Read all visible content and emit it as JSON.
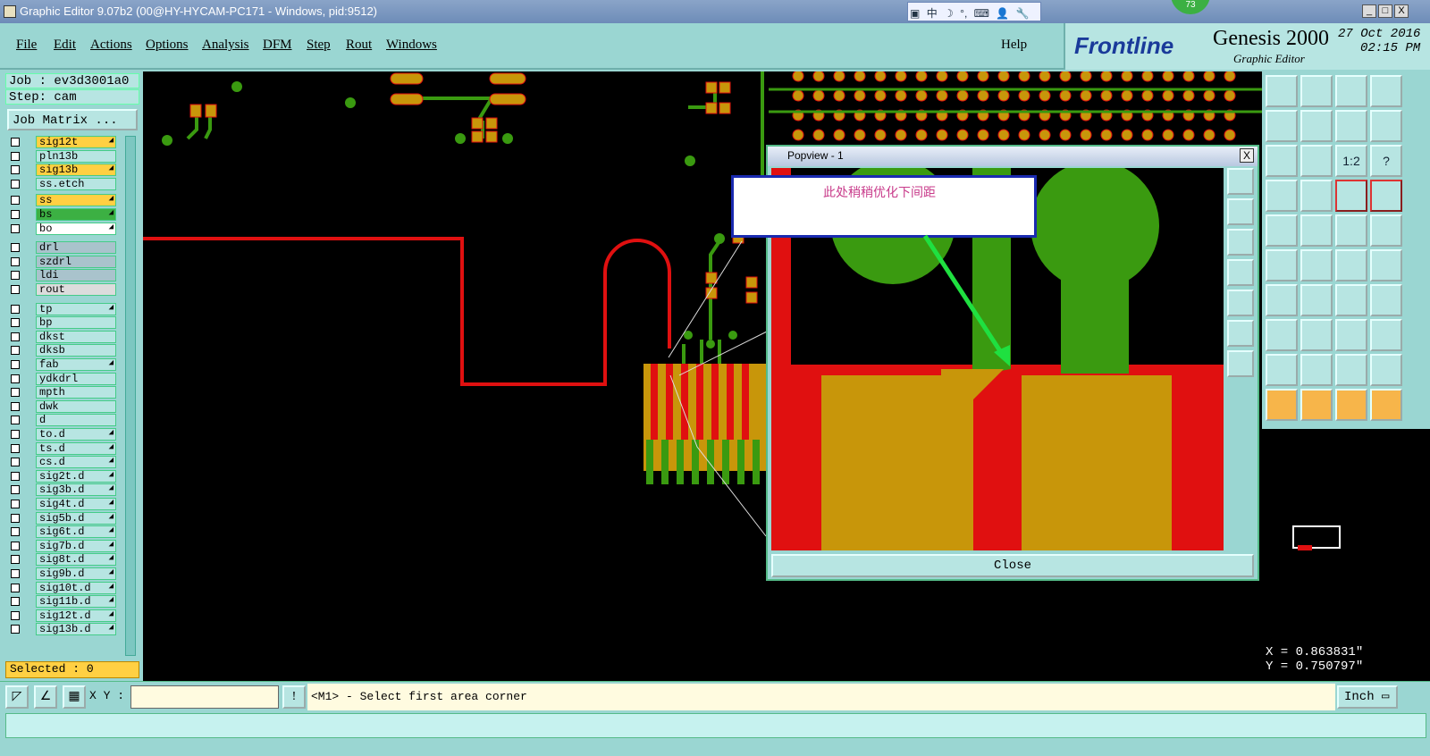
{
  "window": {
    "title": "Graphic Editor 9.07b2 (00@HY-HYCAM-PC171 - Windows, pid:9512)",
    "badge": "73",
    "min": "_",
    "max": "□",
    "close": "X"
  },
  "ime": {
    "items": [
      "中",
      "☽",
      "°,",
      "⌨",
      "👤",
      "🔧"
    ]
  },
  "menu": {
    "items": [
      "File",
      "Edit",
      "Actions",
      "Options",
      "Analysis",
      "DFM",
      "Step",
      "Rout",
      "Windows"
    ],
    "help": "Help"
  },
  "brand": {
    "logo": "Frontline",
    "product": "Genesis 2000",
    "subtitle": "Graphic Editor",
    "date": "27 Oct 2016",
    "time": "02:15 PM"
  },
  "left": {
    "job": "Job : ev3d3001a0",
    "step": "Step: cam",
    "job_matrix": "Job Matrix ...",
    "selected": "Selected : 0",
    "layers": [
      {
        "name": "sig12t",
        "color": "#ffd043",
        "arrow": true
      },
      {
        "name": "pln13b",
        "color": "#b7e5e2",
        "arrow": false
      },
      {
        "name": "sig13b",
        "color": "#ffd043",
        "arrow": true
      },
      {
        "name": "ss.etch",
        "color": "#b7e5e2",
        "arrow": false
      },
      {
        "name": "ss",
        "color": "#ffd043",
        "arrow": true
      },
      {
        "name": "bs",
        "color": "#3cb043",
        "arrow": true
      },
      {
        "name": "bo",
        "color": "#ffffff",
        "arrow": true
      },
      {
        "name": "drl",
        "color": "#a9c3cc",
        "arrow": false
      },
      {
        "name": "szdrl",
        "color": "#a9c3cc",
        "arrow": false
      },
      {
        "name": "ldi",
        "color": "#a9c3cc",
        "arrow": false
      },
      {
        "name": "rout",
        "color": "#dcdcdc",
        "arrow": false
      },
      {
        "name": "tp",
        "color": "#b7e5e2",
        "arrow": true
      },
      {
        "name": "bp",
        "color": "#b7e5e2",
        "arrow": false
      },
      {
        "name": "dkst",
        "color": "#b7e5e2",
        "arrow": false
      },
      {
        "name": "dksb",
        "color": "#b7e5e2",
        "arrow": false
      },
      {
        "name": "fab",
        "color": "#b7e5e2",
        "arrow": true
      },
      {
        "name": "ydkdrl",
        "color": "#b7e5e2",
        "arrow": false
      },
      {
        "name": "mpth",
        "color": "#b7e5e2",
        "arrow": false
      },
      {
        "name": "dwk",
        "color": "#b7e5e2",
        "arrow": false
      },
      {
        "name": "d",
        "color": "#b7e5e2",
        "arrow": false
      },
      {
        "name": "to.d",
        "color": "#b7e5e2",
        "arrow": true
      },
      {
        "name": "ts.d",
        "color": "#b7e5e2",
        "arrow": true
      },
      {
        "name": "cs.d",
        "color": "#b7e5e2",
        "arrow": true
      },
      {
        "name": "sig2t.d",
        "color": "#b7e5e2",
        "arrow": true
      },
      {
        "name": "sig3b.d",
        "color": "#b7e5e2",
        "arrow": true
      },
      {
        "name": "sig4t.d",
        "color": "#b7e5e2",
        "arrow": true
      },
      {
        "name": "sig5b.d",
        "color": "#b7e5e2",
        "arrow": true
      },
      {
        "name": "sig6t.d",
        "color": "#b7e5e2",
        "arrow": true
      },
      {
        "name": "sig7b.d",
        "color": "#b7e5e2",
        "arrow": true
      },
      {
        "name": "sig8t.d",
        "color": "#b7e5e2",
        "arrow": true
      },
      {
        "name": "sig9b.d",
        "color": "#b7e5e2",
        "arrow": true
      },
      {
        "name": "sig10t.d",
        "color": "#b7e5e2",
        "arrow": true
      },
      {
        "name": "sig11b.d",
        "color": "#b7e5e2",
        "arrow": true
      },
      {
        "name": "sig12t.d",
        "color": "#b7e5e2",
        "arrow": true
      },
      {
        "name": "sig13b.d",
        "color": "#b7e5e2",
        "arrow": true
      }
    ]
  },
  "popview": {
    "title": "Popview - 1",
    "close": "Close",
    "close_x": "X"
  },
  "callout": {
    "text": "此处稍稍优化下间距"
  },
  "toolbox": {
    "buttons": [
      "home",
      "nav-down",
      "house",
      "zoom-window",
      "move-left",
      "move-right",
      "flip",
      "rotate",
      "fit",
      "center",
      "1:2",
      "help",
      "pen",
      "grid",
      "layers",
      "layers2",
      "drill",
      "route",
      "ruler",
      "dot",
      "connect",
      "cross",
      "arrow-a",
      "arrow-b",
      "line-a",
      "line-b",
      "undo",
      "snap",
      "pad",
      "mid",
      "measure",
      "group",
      "tri-a",
      "tri-b",
      "tri-c",
      "tri-d",
      "select",
      "select-b",
      "select-c",
      "select-d"
    ],
    "ratio_label": "1:2",
    "help_label": "?"
  },
  "coords": {
    "x": "X = 0.863831\"",
    "y": "Y = 0.750797\""
  },
  "bottom": {
    "xy_label": "X Y :",
    "xy_value": "",
    "message": "<M1> - Select first area corner",
    "unit": "Inch",
    "warn": "!"
  },
  "colors": {
    "panel": "#9ad6d2",
    "canvas": "#000000",
    "copper": "#3a9a10",
    "pad": "#c8960a",
    "route": "#e01010",
    "callout_border": "#1a2ab0",
    "callout_text": "#c83a8a",
    "arrow": "#1fe040"
  }
}
